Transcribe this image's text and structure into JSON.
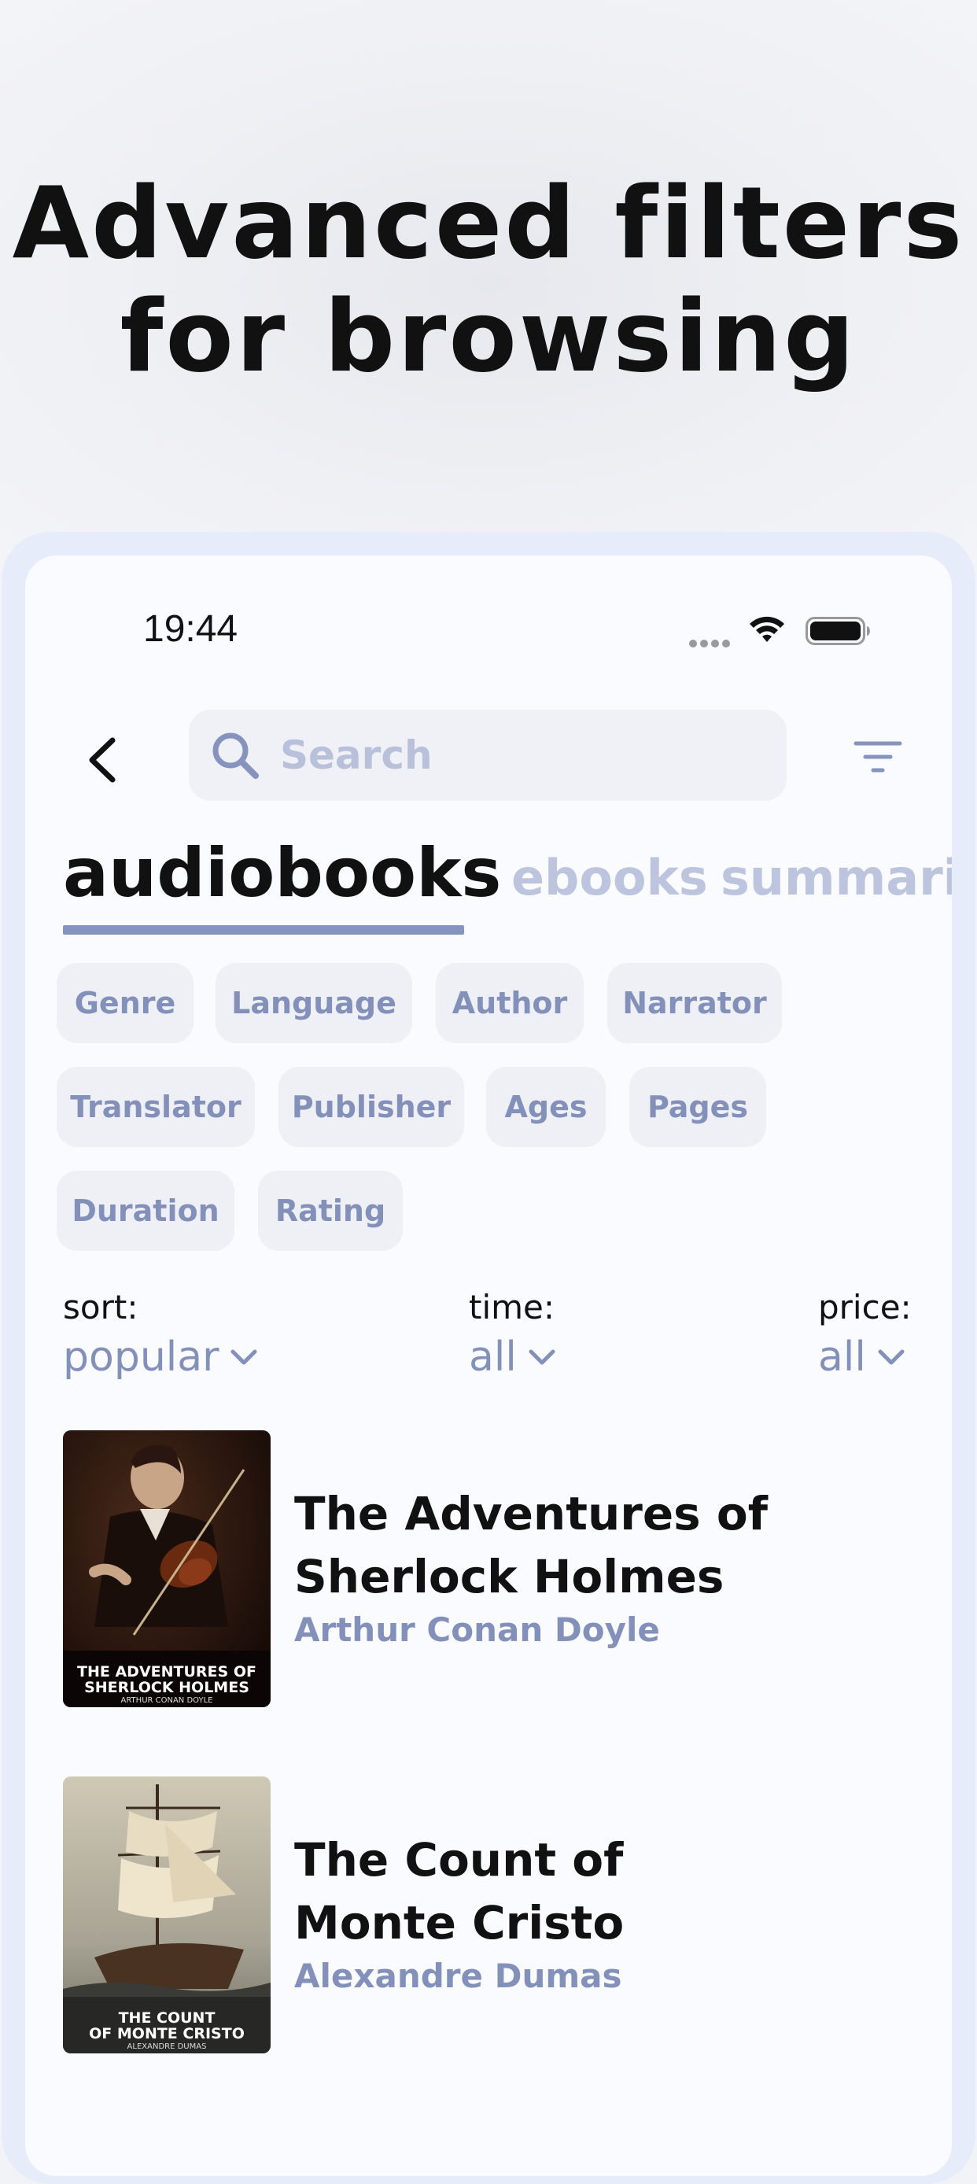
{
  "headline": {
    "line1": "Advanced filters",
    "line2": "for browsing"
  },
  "status_bar": {
    "time": "19:44"
  },
  "search": {
    "placeholder": "Search"
  },
  "tabs": [
    {
      "label": "audiobooks",
      "active": true
    },
    {
      "label": "ebooks",
      "active": false
    },
    {
      "label": "summari",
      "active": false
    }
  ],
  "filter_chips": [
    {
      "label": "Genre"
    },
    {
      "label": "Language"
    },
    {
      "label": "Author"
    },
    {
      "label": "Narrator"
    },
    {
      "label": "Translator"
    },
    {
      "label": "Publisher"
    },
    {
      "label": "Ages"
    },
    {
      "label": "Pages"
    },
    {
      "label": "Duration"
    },
    {
      "label": "Rating"
    }
  ],
  "sort_controls": {
    "sort": {
      "label": "sort:",
      "value": "popular"
    },
    "time": {
      "label": "time:",
      "value": "all"
    },
    "price": {
      "label": "price:",
      "value": "all"
    }
  },
  "books": [
    {
      "title_line1": "The Adventures of",
      "title_line2": "Sherlock Holmes",
      "author": "Arthur Conan Doyle",
      "cover_title_line1": "THE ADVENTURES OF",
      "cover_title_line2": "SHERLOCK HOLMES",
      "cover_author": "ARTHUR CONAN DOYLE"
    },
    {
      "title_line1": "The Count of",
      "title_line2": "Monte Cristo",
      "author": "Alexandre Dumas",
      "cover_title_line1": "THE COUNT",
      "cover_title_line2": "OF MONTE CRISTO",
      "cover_author": "ALEXANDRE DUMAS"
    }
  ],
  "colors": {
    "accent": "#8593be",
    "inactive_tab": "#bdc4de",
    "chip_background": "#eef0f5",
    "device_frame": "#e7ecfa"
  }
}
